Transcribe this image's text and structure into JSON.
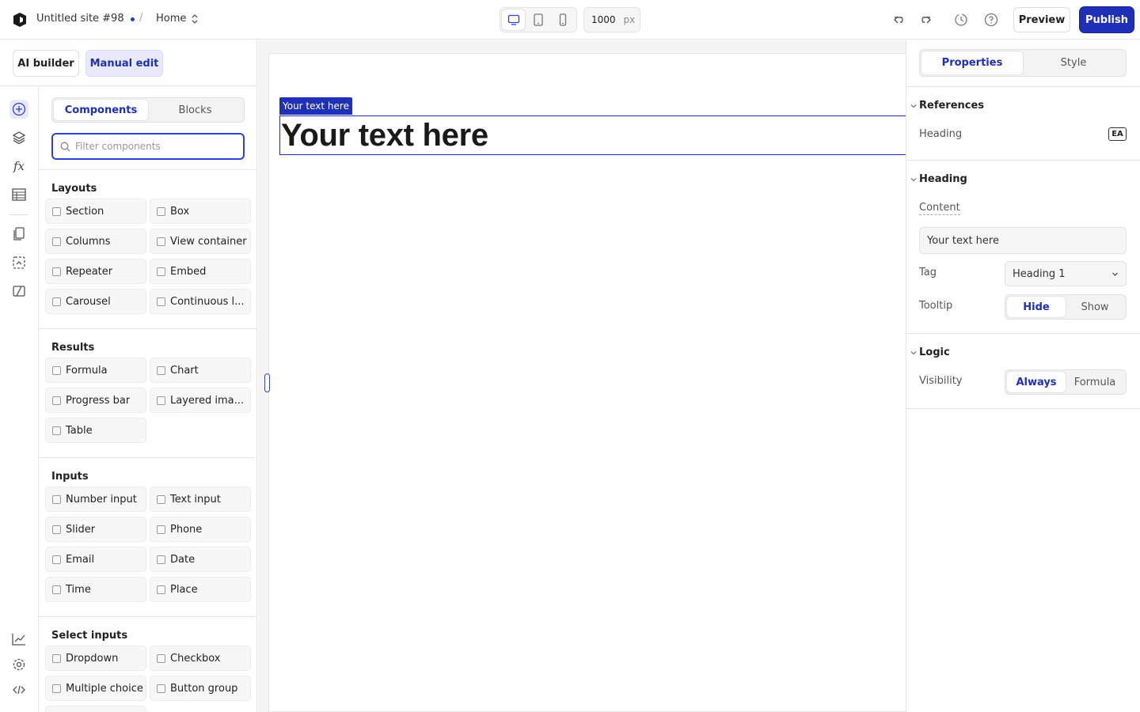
{
  "topbar": {
    "site_name": "Untitled site #98",
    "separator": "/",
    "page": "Home",
    "width_value": "1000",
    "width_unit": "px",
    "preview_label": "Preview",
    "publish_label": "Publish"
  },
  "modes": {
    "ai_label": "AI builder",
    "manual_label": "Manual edit",
    "active": "manual"
  },
  "rail": {
    "items": [
      "add-icon",
      "layers-icon",
      "formula-icon",
      "table-icon",
      "pages-icon",
      "assets-icon",
      "theme-icon"
    ],
    "bottom_items": [
      "analytics-icon",
      "settings-icon",
      "code-icon"
    ]
  },
  "panel": {
    "tabs": [
      "Components",
      "Blocks"
    ],
    "active_tab": "Components",
    "search_placeholder": "Filter components",
    "groups": [
      {
        "title": "Layouts",
        "items": [
          "Section",
          "Box",
          "Columns",
          "View container",
          "Repeater",
          "Embed",
          "Carousel",
          "Continuous l..."
        ]
      },
      {
        "title": "Results",
        "items": [
          "Formula",
          "Chart",
          "Progress bar",
          "Layered ima...",
          "Table"
        ]
      },
      {
        "title": "Inputs",
        "items": [
          "Number input",
          "Text input",
          "Slider",
          "Phone",
          "Email",
          "Date",
          "Time",
          "Place"
        ]
      },
      {
        "title": "Select inputs",
        "items": [
          "Dropdown",
          "Checkbox",
          "Multiple choice",
          "Button group"
        ]
      }
    ]
  },
  "canvas": {
    "selection_tag": "Your text here",
    "heading_text": "Your text here"
  },
  "inspector": {
    "tabs": [
      "Properties",
      "Style"
    ],
    "active_tab": "Properties",
    "references": {
      "title": "References",
      "label": "Heading",
      "badge": "EA"
    },
    "heading": {
      "title": "Heading",
      "content_label": "Content",
      "content_value": "Your text here",
      "tag_label": "Tag",
      "tag_value": "Heading 1",
      "tooltip_label": "Tooltip",
      "tooltip_options": [
        "Hide",
        "Show"
      ],
      "tooltip_active": "Hide"
    },
    "logic": {
      "title": "Logic",
      "visibility_label": "Visibility",
      "visibility_options": [
        "Always",
        "Formula"
      ],
      "visibility_active": "Always"
    }
  },
  "colors": {
    "accent": "#1f2fb8",
    "accent_soft": "#e8eafb",
    "border": "#e5e5e5"
  }
}
